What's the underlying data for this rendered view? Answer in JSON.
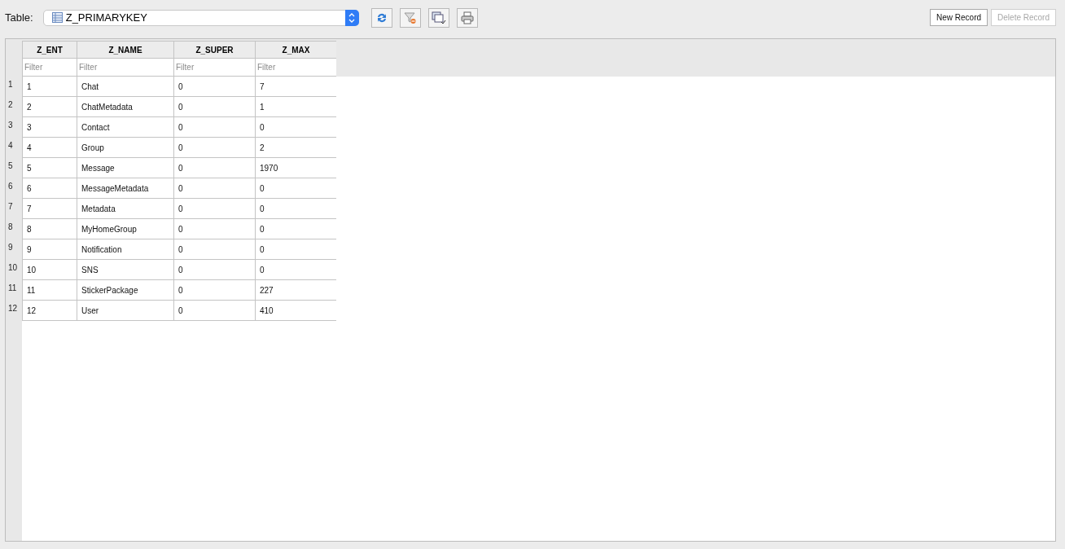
{
  "toolbar": {
    "label": "Table:",
    "table_select": {
      "value": "Z_PRIMARYKEY"
    },
    "buttons": [
      {
        "label": "New Record",
        "disabled": false
      },
      {
        "label": "Delete Record",
        "disabled": true
      }
    ]
  },
  "table": {
    "columns": [
      {
        "name": "Z_ENT",
        "filter_placeholder": "Filter"
      },
      {
        "name": "Z_NAME",
        "filter_placeholder": "Filter"
      },
      {
        "name": "Z_SUPER",
        "filter_placeholder": "Filter"
      },
      {
        "name": "Z_MAX",
        "filter_placeholder": "Filter"
      }
    ],
    "rows": [
      {
        "number": "1",
        "cells": [
          "1",
          "Chat",
          "0",
          "7"
        ]
      },
      {
        "number": "2",
        "cells": [
          "2",
          "ChatMetadata",
          "0",
          "1"
        ]
      },
      {
        "number": "3",
        "cells": [
          "3",
          "Contact",
          "0",
          "0"
        ]
      },
      {
        "number": "4",
        "cells": [
          "4",
          "Group",
          "0",
          "2"
        ]
      },
      {
        "number": "5",
        "cells": [
          "5",
          "Message",
          "0",
          "1970"
        ]
      },
      {
        "number": "6",
        "cells": [
          "6",
          "MessageMetadata",
          "0",
          "0"
        ]
      },
      {
        "number": "7",
        "cells": [
          "7",
          "Metadata",
          "0",
          "0"
        ]
      },
      {
        "number": "8",
        "cells": [
          "8",
          "MyHomeGroup",
          "0",
          "0"
        ]
      },
      {
        "number": "9",
        "cells": [
          "9",
          "Notification",
          "0",
          "0"
        ]
      },
      {
        "number": "10",
        "cells": [
          "10",
          "SNS",
          "0",
          "0"
        ]
      },
      {
        "number": "11",
        "cells": [
          "11",
          "StickerPackage",
          "0",
          "227"
        ]
      },
      {
        "number": "12",
        "cells": [
          "12",
          "User",
          "0",
          "410"
        ]
      }
    ]
  }
}
